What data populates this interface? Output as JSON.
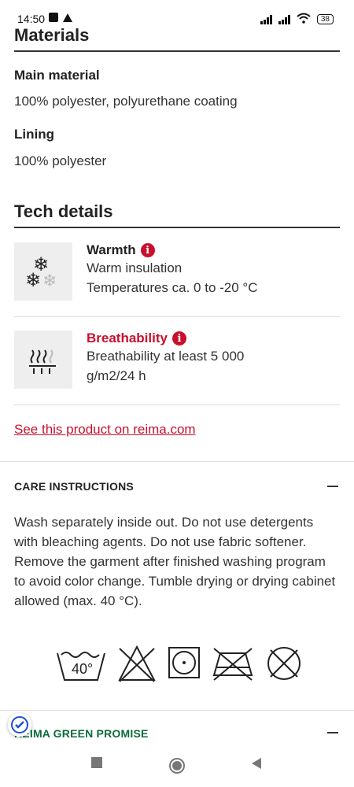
{
  "status": {
    "time": "14:50",
    "battery": "38"
  },
  "materials": {
    "title": "Materials",
    "main_label": "Main material",
    "main_value": "100% polyester, polyurethane coating",
    "lining_label": "Lining",
    "lining_value": "100% polyester"
  },
  "tech": {
    "title": "Tech details",
    "items": [
      {
        "title": "Warmth",
        "lines": [
          "Warm insulation",
          "Temperatures ca. 0 to -20 °C"
        ],
        "icon": "snowflake-icon",
        "title_color": "#222222"
      },
      {
        "title": "Breathability",
        "lines": [
          "Breathability at least 5 000",
          "g/m2/24 h"
        ],
        "icon": "breathability-icon",
        "title_color": "#c8102e"
      }
    ]
  },
  "link_text": "See this product on reima.com",
  "care": {
    "title": "CARE INSTRUCTIONS",
    "text": "Wash separately inside out. Do not use detergents with bleaching agents. Do not use fabric softener. Remove the garment after finished washing program to avoid color change. Tumble drying or drying cabinet allowed (max. 40 °C).",
    "wash_temp": "40°"
  },
  "green": {
    "title": "REIMA GREEN PROMISE"
  },
  "colors": {
    "accent": "#c8102e",
    "green": "#0b6b3a"
  }
}
